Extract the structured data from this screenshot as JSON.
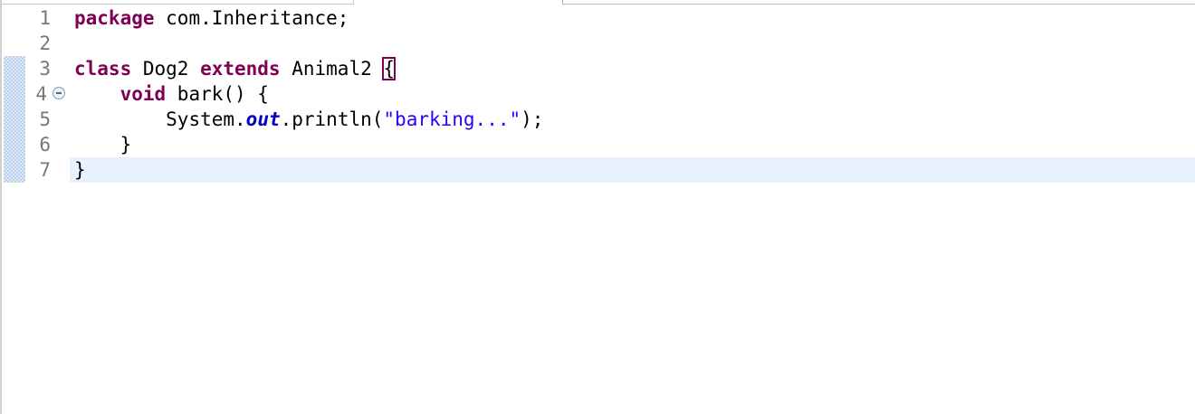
{
  "editor": {
    "line_numbers": [
      "1",
      "2",
      "3",
      "4",
      "5",
      "6",
      "7"
    ],
    "code": {
      "line1": {
        "kw": "package",
        "rest": " com.Inheritance;"
      },
      "line3": {
        "kw1": "class",
        "t1": " Dog2 ",
        "kw2": "extends",
        "t2": " Animal2 ",
        "brace": "{"
      },
      "line4": {
        "indent": "    ",
        "kw": "void",
        "rest": " bark() {"
      },
      "line5": {
        "indent": "        ",
        "t1": "System.",
        "field": "out",
        "t2": ".println(",
        "str": "\"barking...\"",
        "t3": ");"
      },
      "line6": {
        "text": "    }"
      },
      "line7": {
        "text": "}"
      }
    },
    "icons": {
      "fold": "collapse-minus-icon"
    },
    "colors": {
      "keyword": "#7f0055",
      "string": "#2a00ff",
      "static_field": "#0000c0",
      "current_line": "#e8f2fe",
      "line_number": "#787878"
    }
  }
}
